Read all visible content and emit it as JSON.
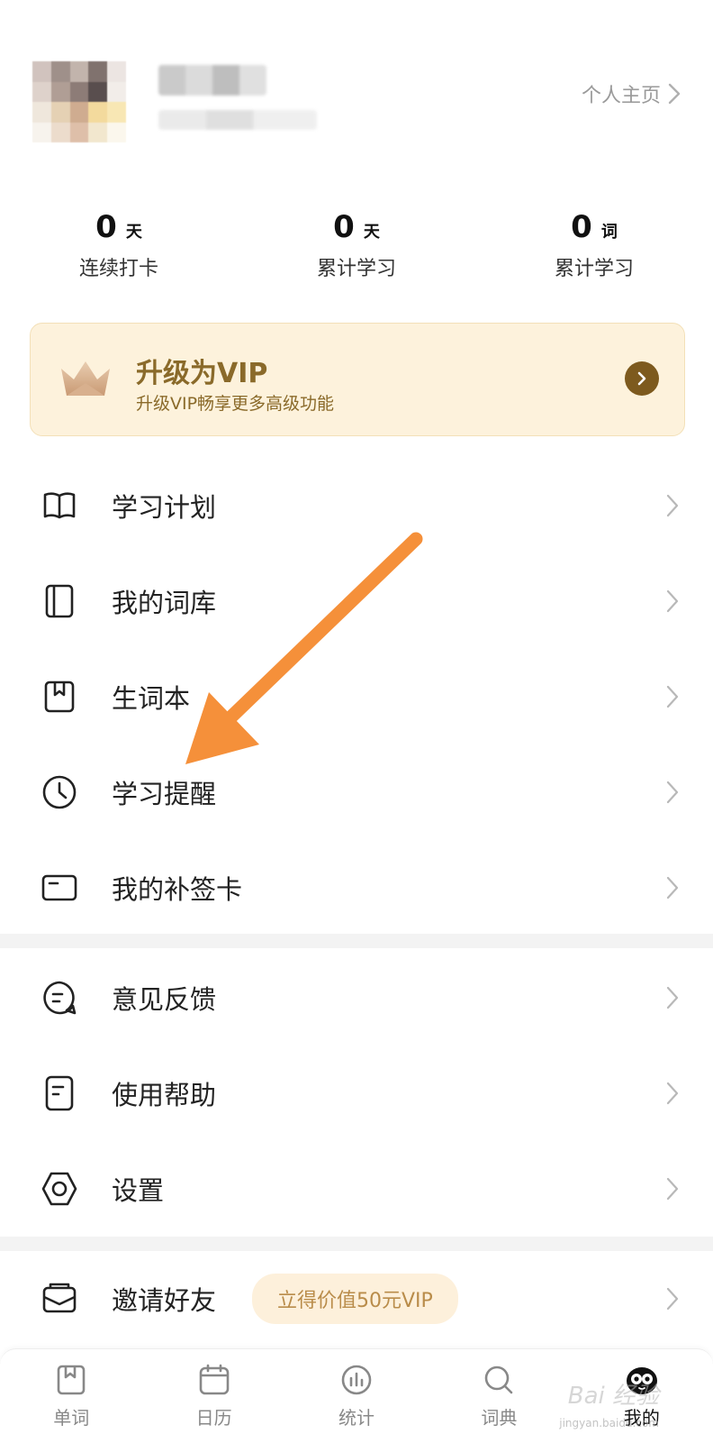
{
  "profile": {
    "home_link": "个人主页"
  },
  "stats": [
    {
      "value": "0",
      "unit": "天",
      "label": "连续打卡"
    },
    {
      "value": "0",
      "unit": "天",
      "label": "累计学习"
    },
    {
      "value": "0",
      "unit": "词",
      "label": "累计学习"
    }
  ],
  "vip": {
    "title": "升级为VIP",
    "subtitle": "升级VIP畅享更多高级功能",
    "icon": "crown-icon"
  },
  "menu_group_1": [
    {
      "label": "学习计划",
      "icon": "book-icon"
    },
    {
      "label": "我的词库",
      "icon": "word-bank-icon"
    },
    {
      "label": "生词本",
      "icon": "notebook-icon"
    },
    {
      "label": "学习提醒",
      "icon": "clock-icon"
    },
    {
      "label": "我的补签卡",
      "icon": "card-icon"
    }
  ],
  "menu_group_2": [
    {
      "label": "意见反馈",
      "icon": "feedback-icon"
    },
    {
      "label": "使用帮助",
      "icon": "help-doc-icon"
    },
    {
      "label": "设置",
      "icon": "settings-icon"
    }
  ],
  "invite": {
    "label": "邀请好友",
    "promo": "立得价值50元VIP",
    "icon": "envelope-icon"
  },
  "bottom_nav": [
    {
      "label": "单词",
      "icon": "bookmark-book-icon"
    },
    {
      "label": "日历",
      "icon": "calendar-icon"
    },
    {
      "label": "统计",
      "icon": "chart-icon"
    },
    {
      "label": "词典",
      "icon": "search-icon"
    },
    {
      "label": "我的",
      "icon": "mascot-icon",
      "active": true
    }
  ],
  "watermark": {
    "main": "Bai 经验",
    "sub": "jingyan.baidu.com"
  },
  "colors": {
    "vip_bg": "#fdf2dc",
    "vip_text": "#8a6a2a",
    "annotation_arrow": "#f5903a"
  }
}
